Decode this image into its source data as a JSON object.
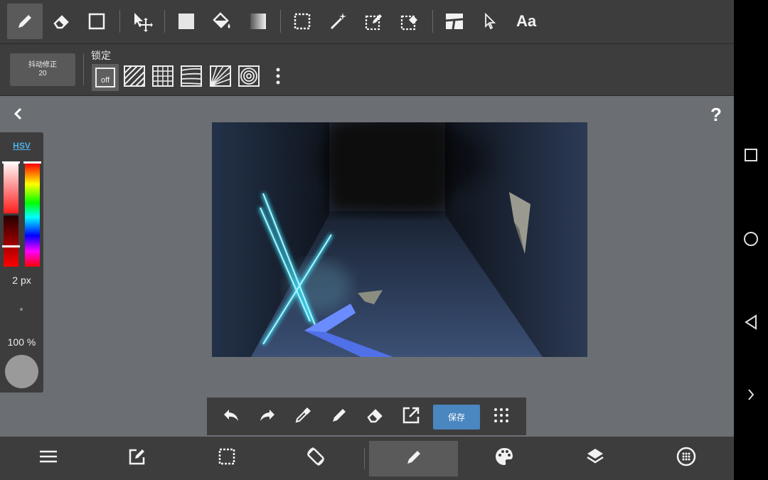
{
  "toolbar": {
    "tools": [
      "pen-tool",
      "eraser-tool",
      "shape-tool",
      "move-tool",
      "fill-rect-tool",
      "bucket-tool",
      "gradient-tool",
      "select-rect-tool",
      "magic-wand-tool",
      "select-pen-tool",
      "select-eraser-tool",
      "frame-divider-tool",
      "operation-tool",
      "text-tool"
    ],
    "text_tool_label": "Aa"
  },
  "subbar": {
    "stabilizer_label": "抖动修正",
    "stabilizer_value": "20",
    "lock_label": "锁定",
    "ruler_off_label": "off"
  },
  "color_panel": {
    "mode_label": "HSV",
    "brush_size": "2 px",
    "opacity": "100 %",
    "current_color": "#9a9a9a"
  },
  "bottom_tools": {
    "save_label": "保存"
  },
  "colors": {
    "panel_bg": "#3d3d3d",
    "workspace_bg": "#6b6e73",
    "accent": "#4a86c0",
    "hsv_link": "#4fb0e8"
  }
}
